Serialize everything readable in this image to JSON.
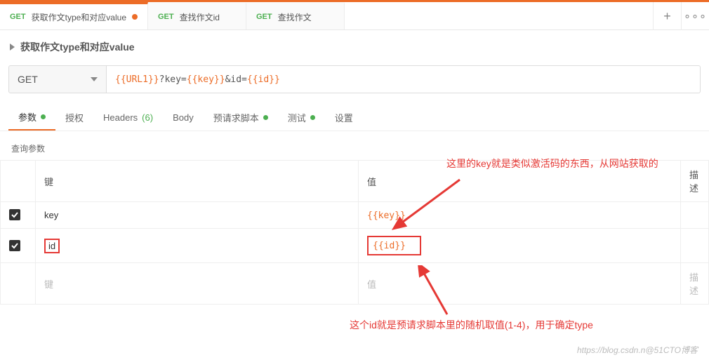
{
  "tabs": [
    {
      "method": "GET",
      "title": "获取作文type和对应value",
      "active": true,
      "dirty": true
    },
    {
      "method": "GET",
      "title": "查找作文id",
      "active": false
    },
    {
      "method": "GET",
      "title": "查找作文",
      "active": false
    }
  ],
  "request": {
    "title": "获取作文type和对应value",
    "method": "GET",
    "url_prefix": "{{URL1}}",
    "url_middle": "?key=",
    "url_key": "{{key}}",
    "url_mid2": "&id=",
    "url_id": "{{id}}"
  },
  "sectionTabs": {
    "params": "参数",
    "auth": "授权",
    "headers": "Headers",
    "headersCount": "(6)",
    "body": "Body",
    "prereq": "预请求脚本",
    "tests": "测试",
    "settings": "设置"
  },
  "subhead": "查询参数",
  "tableHead": {
    "key": "键",
    "value": "值",
    "desc": "描述"
  },
  "rows": [
    {
      "key": "key",
      "value": "{{key}}"
    },
    {
      "key": "id",
      "value": "{{id}}"
    }
  ],
  "placeholders": {
    "key": "键",
    "value": "值",
    "desc": "描述"
  },
  "annotations": {
    "a1": "这里的key就是类似激活码的东西，从网站获取的",
    "a2": "这个id就是预请求脚本里的随机取值(1-4)，用于确定type"
  },
  "watermark": "https://blog.csdn.n@51CTO博客"
}
